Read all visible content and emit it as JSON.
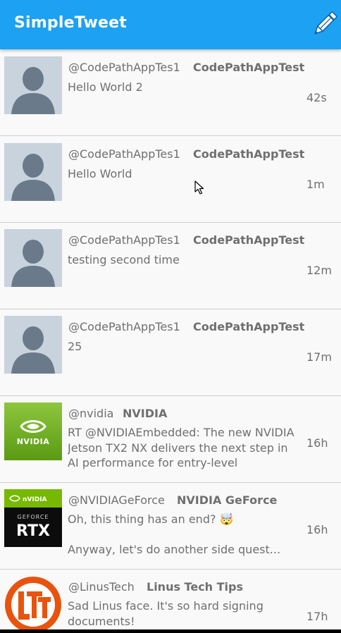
{
  "app": {
    "title": "SimpleTweet",
    "brand_color": "#1da1f2",
    "compose_icon": "pencil-icon"
  },
  "tweets": [
    {
      "handle": "@CodePathAppTes1",
      "name": "CodePathAppTest",
      "text": "Hello World 2",
      "time": "42s",
      "avatar": "default-avatar-icon"
    },
    {
      "handle": "@CodePathAppTes1",
      "name": "CodePathAppTest",
      "text": "Hello World",
      "time": "1m",
      "avatar": "default-avatar-icon"
    },
    {
      "handle": "@CodePathAppTes1",
      "name": "CodePathAppTest",
      "text": "testing second time",
      "time": "12m",
      "avatar": "default-avatar-icon"
    },
    {
      "handle": "@CodePathAppTes1",
      "name": "CodePathAppTest",
      "text": "25",
      "time": "17m",
      "avatar": "default-avatar-icon"
    },
    {
      "handle": "@nvidia",
      "name": "NVIDIA",
      "text": "RT @NVIDIAEmbedded: The new NVIDIA Jetson TX2 NX delivers the next step in AI performance for entry-level",
      "time": "16h",
      "avatar": "nvidia-logo"
    },
    {
      "handle": "@NVIDIAGeForce",
      "name": "NVIDIA GeForce",
      "text": "Oh, this thing has an end? 🤯",
      "text2": "Anyway, let's do another side quest...",
      "time": "16h",
      "avatar": "geforce-rtx-logo"
    },
    {
      "handle": "@LinusTech",
      "name": "Linus Tech Tips",
      "text": "Sad Linus face. It's so hard signing documents!",
      "time": "17h",
      "avatar": "ltt-logo"
    }
  ]
}
